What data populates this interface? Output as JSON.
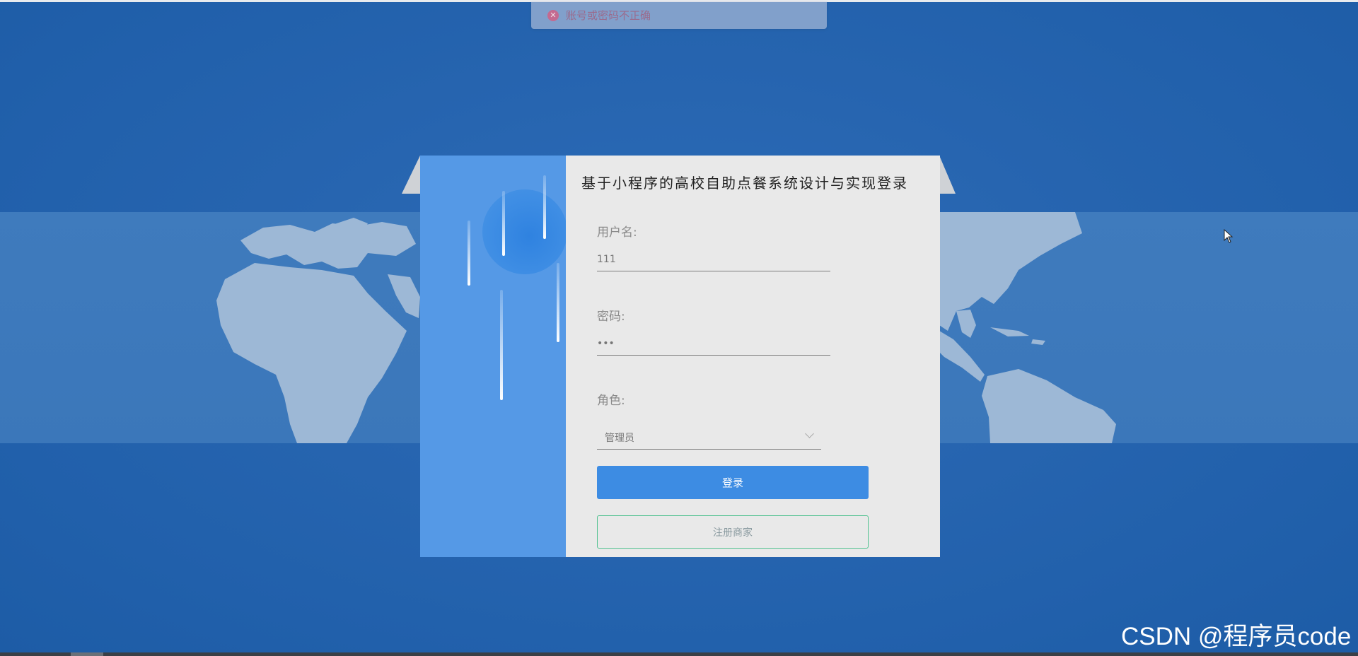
{
  "toast": {
    "icon": "close-circle-icon",
    "message": "账号或密码不正确",
    "accent": "#c46a90"
  },
  "login": {
    "title": "基于小程序的高校自助点餐系统设计与实现登录",
    "username_label": "用户名:",
    "username_value": "111",
    "password_label": "密码:",
    "password_value": "•••",
    "role_label": "角色:",
    "role_value": "管理员",
    "login_button": "登录",
    "register_button": "注册商家"
  },
  "colors": {
    "background": "#2765b0",
    "panel_left": "#5599e6",
    "primary": "#3d8ce3",
    "register_border": "#4fc18f"
  },
  "watermark": "CSDN @程序员code"
}
